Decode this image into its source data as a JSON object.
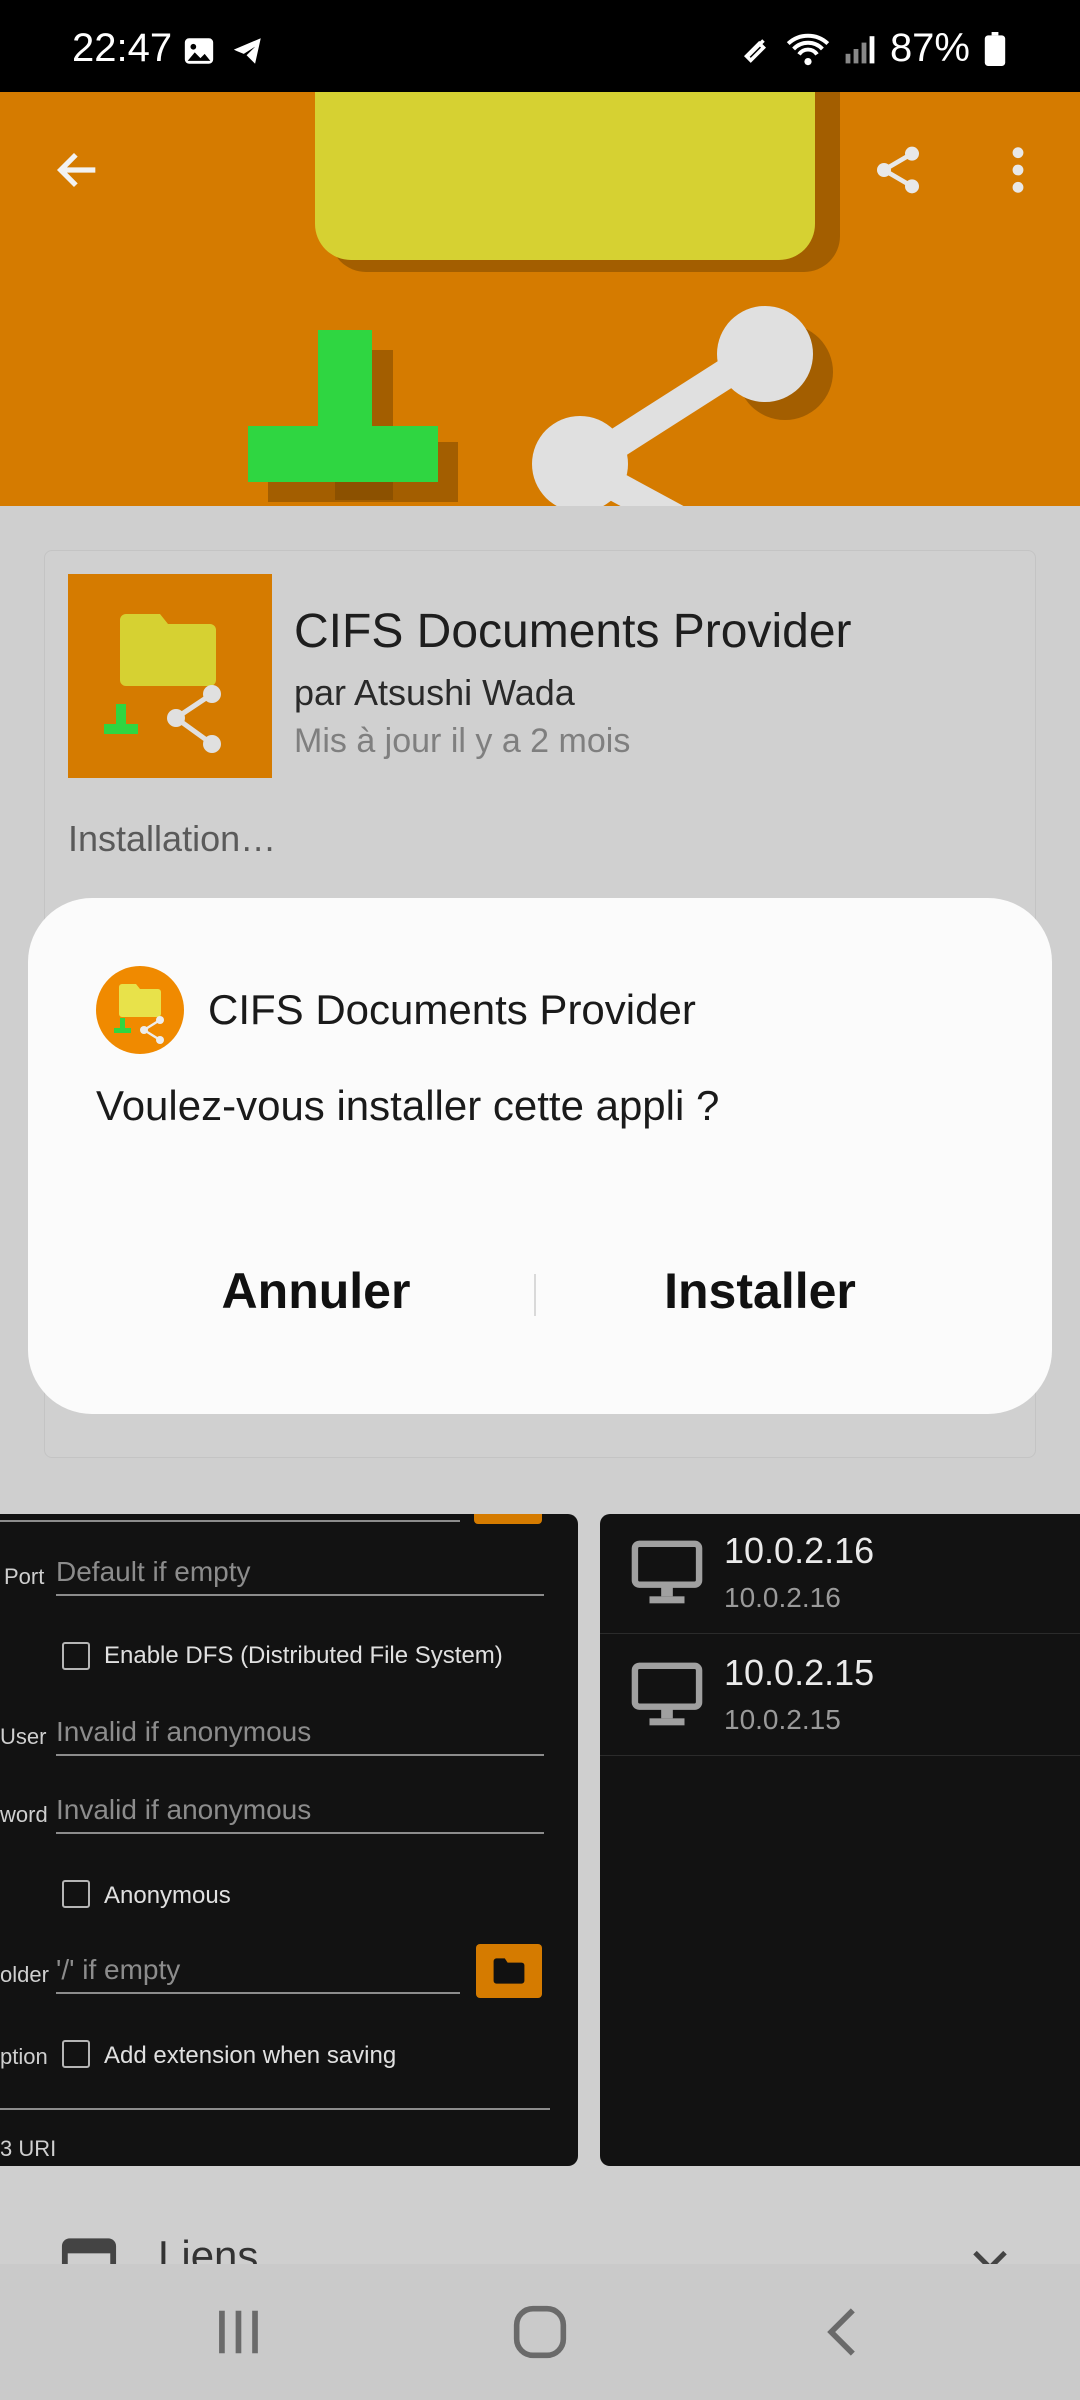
{
  "status_bar": {
    "time": "22:47",
    "battery": "87%",
    "icons": [
      "gallery-icon",
      "telegram-icon",
      "no-sound-icon",
      "wifi-icon",
      "signal-icon",
      "battery-icon"
    ]
  },
  "header": {
    "back_label": "back",
    "actions": [
      "share-icon",
      "more-options-icon"
    ],
    "background_color": "#d57b00"
  },
  "app": {
    "name": "CIFS Documents Provider",
    "author": "par Atsushi Wada",
    "updated": "Mis à jour il y a 2 mois",
    "status": "Installation…"
  },
  "dialog": {
    "app_name": "CIFS Documents Provider",
    "message": "Voulez-vous installer cette appli ?",
    "cancel_label": "Annuler",
    "install_label": "Installer"
  },
  "screenshot_left": {
    "port_label": "Port",
    "port_placeholder": "Default if empty",
    "dfs_label": "Enable DFS (Distributed File System)",
    "user_label": "User",
    "user_placeholder": "Invalid if anonymous",
    "password_label": "word",
    "password_placeholder": "Invalid if anonymous",
    "anonymous_label": "Anonymous",
    "folder_label": "older",
    "folder_placeholder": "'/' if empty",
    "option_label": "ption",
    "extension_label": "Add extension when saving",
    "uri_label": "3 URI"
  },
  "screenshot_right": {
    "hosts": [
      {
        "title": "10.0.2.16",
        "subtitle": "10.0.2.16"
      },
      {
        "title": "10.0.2.15",
        "subtitle": "10.0.2.15"
      }
    ]
  },
  "links": {
    "label": "Liens"
  },
  "nav_bar": {
    "buttons": [
      "recents-icon",
      "home-icon",
      "back-icon"
    ]
  }
}
